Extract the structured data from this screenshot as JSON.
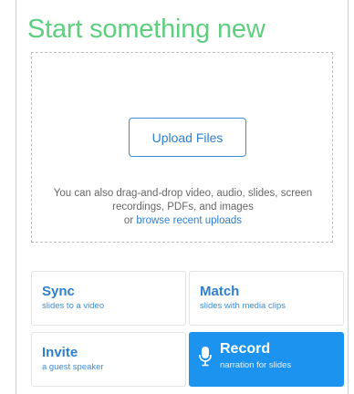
{
  "header": {
    "title": "Start something new"
  },
  "upload": {
    "button_label": "Upload Files",
    "hint_text": "You can also drag-and-drop video, audio, slides, screen recordings, PDFs, and images",
    "hint_prefix": "or ",
    "browse_link": "browse recent uploads"
  },
  "actions": {
    "sync": {
      "title": "Sync",
      "subtitle": "slides to a video"
    },
    "match": {
      "title": "Match",
      "subtitle": "slides with media clips"
    },
    "invite": {
      "title": "Invite",
      "subtitle": "a guest speaker"
    },
    "record": {
      "title": "Record",
      "subtitle": "narration for slides",
      "icon": "microphone-icon"
    }
  },
  "colors": {
    "title_green": "#5fcf7f",
    "link_blue": "#2f7fcc",
    "record_bg": "#1d93f0"
  }
}
